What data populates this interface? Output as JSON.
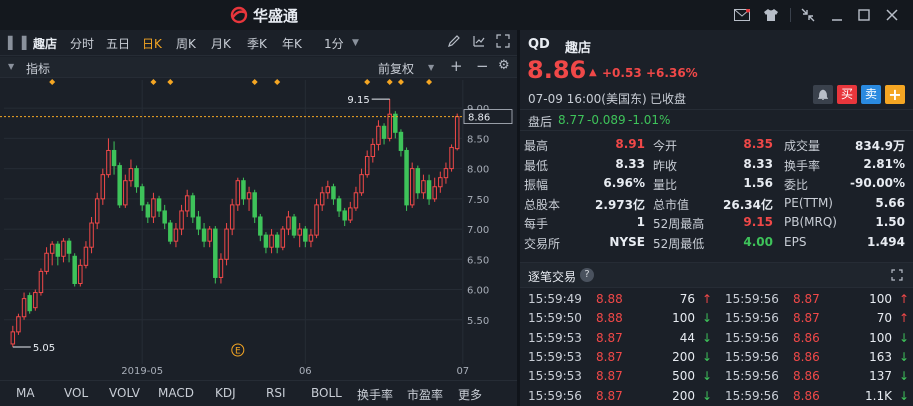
{
  "app": {
    "title": "华盛通",
    "brand_color": "#e8363c"
  },
  "toolbar": {
    "tabs": [
      "趣店",
      "分时",
      "五日",
      "日K",
      "周K",
      "月K",
      "季K",
      "年K",
      "1分"
    ],
    "active_tab": "日K",
    "icons": [
      "pen-icon",
      "draw-icon",
      "crosshair-icon",
      "fullscreen-icon"
    ]
  },
  "indicator_bar": {
    "label": "指标",
    "adjust": "前复权"
  },
  "chart_data": {
    "type": "candlestick",
    "ylim": [
      5.0,
      9.3
    ],
    "y_ticks": [
      "9.00",
      "8.50",
      "8.00",
      "7.50",
      "7.00",
      "6.50",
      "6.00",
      "5.50"
    ],
    "x_ticks": [
      {
        "label": "2019-05",
        "index": 23
      },
      {
        "label": "06",
        "index": 52
      },
      {
        "label": "07",
        "index": 80
      }
    ],
    "price_line": "8.86",
    "high_marker": "9.15",
    "low_marker": "5.05",
    "earnings_marker": {
      "label": "E",
      "index": 40
    },
    "candles": [
      [
        5.1,
        5.3,
        5.05,
        5.4
      ],
      [
        5.3,
        5.55,
        5.25,
        5.6
      ],
      [
        5.55,
        5.85,
        5.5,
        5.95
      ],
      [
        5.9,
        5.65,
        5.6,
        5.95
      ],
      [
        5.7,
        5.95,
        5.65,
        6.0
      ],
      [
        5.95,
        6.3,
        5.9,
        6.35
      ],
      [
        6.3,
        6.6,
        6.25,
        6.7
      ],
      [
        6.6,
        6.75,
        6.4,
        6.8
      ],
      [
        6.75,
        6.55,
        6.4,
        6.8
      ],
      [
        6.55,
        6.8,
        6.45,
        6.85
      ],
      [
        6.8,
        6.6,
        6.45,
        6.85
      ],
      [
        6.55,
        6.1,
        6.05,
        6.6
      ],
      [
        6.1,
        6.4,
        6.05,
        6.5
      ],
      [
        6.4,
        6.7,
        6.35,
        6.8
      ],
      [
        6.7,
        7.1,
        6.6,
        7.2
      ],
      [
        7.1,
        7.5,
        7.0,
        7.6
      ],
      [
        7.5,
        7.9,
        7.4,
        8.0
      ],
      [
        7.9,
        8.3,
        7.85,
        8.5
      ],
      [
        8.3,
        8.05,
        7.9,
        8.45
      ],
      [
        8.05,
        7.4,
        7.35,
        8.1
      ],
      [
        7.4,
        7.8,
        7.35,
        7.9
      ],
      [
        7.8,
        8.0,
        7.7,
        8.15
      ],
      [
        8.0,
        7.7,
        7.6,
        8.05
      ],
      [
        7.7,
        7.4,
        7.3,
        7.75
      ],
      [
        7.4,
        7.2,
        7.1,
        7.45
      ],
      [
        7.2,
        7.5,
        7.1,
        7.6
      ],
      [
        7.5,
        7.3,
        7.2,
        7.55
      ],
      [
        7.3,
        7.1,
        7.0,
        7.4
      ],
      [
        7.1,
        6.8,
        6.75,
        7.15
      ],
      [
        6.8,
        7.0,
        6.7,
        7.1
      ],
      [
        7.0,
        7.3,
        6.9,
        7.4
      ],
      [
        7.3,
        7.55,
        7.2,
        7.65
      ],
      [
        7.55,
        7.2,
        7.1,
        7.6
      ],
      [
        7.2,
        7.0,
        6.9,
        7.3
      ],
      [
        7.0,
        6.8,
        6.7,
        7.1
      ],
      [
        6.8,
        7.0,
        6.7,
        7.05
      ],
      [
        7.0,
        6.2,
        6.1,
        7.05
      ],
      [
        6.2,
        6.5,
        6.1,
        6.6
      ],
      [
        6.5,
        7.0,
        6.4,
        7.1
      ],
      [
        7.0,
        7.4,
        6.9,
        7.5
      ],
      [
        7.4,
        7.8,
        7.3,
        7.85
      ],
      [
        7.8,
        7.5,
        7.4,
        7.85
      ],
      [
        7.5,
        7.6,
        7.3,
        7.7
      ],
      [
        7.6,
        7.2,
        7.1,
        7.65
      ],
      [
        7.2,
        6.9,
        6.8,
        7.25
      ],
      [
        6.9,
        6.7,
        6.6,
        6.95
      ],
      [
        6.7,
        6.9,
        6.6,
        7.0
      ],
      [
        6.9,
        6.7,
        6.6,
        6.95
      ],
      [
        6.7,
        7.0,
        6.65,
        7.05
      ],
      [
        7.0,
        7.2,
        6.9,
        7.3
      ],
      [
        7.2,
        6.9,
        6.85,
        7.25
      ],
      [
        6.9,
        7.0,
        6.7,
        7.1
      ],
      [
        7.0,
        6.8,
        6.7,
        7.05
      ],
      [
        6.8,
        6.9,
        6.7,
        7.0
      ],
      [
        6.9,
        7.4,
        6.85,
        7.5
      ],
      [
        7.4,
        7.6,
        7.3,
        7.7
      ],
      [
        7.6,
        7.7,
        7.5,
        7.8
      ],
      [
        7.7,
        7.5,
        7.4,
        7.75
      ],
      [
        7.5,
        7.3,
        7.2,
        7.55
      ],
      [
        7.3,
        7.15,
        7.05,
        7.35
      ],
      [
        7.15,
        7.35,
        7.1,
        7.45
      ],
      [
        7.35,
        7.6,
        7.3,
        7.7
      ],
      [
        7.6,
        7.9,
        7.55,
        8.0
      ],
      [
        7.9,
        8.2,
        7.85,
        8.3
      ],
      [
        8.2,
        8.4,
        8.1,
        8.5
      ],
      [
        8.4,
        8.7,
        8.3,
        8.8
      ],
      [
        8.7,
        8.5,
        8.4,
        8.75
      ],
      [
        8.5,
        8.9,
        8.45,
        9.15
      ],
      [
        8.9,
        8.6,
        8.5,
        8.95
      ],
      [
        8.6,
        8.3,
        8.2,
        8.65
      ],
      [
        8.3,
        7.4,
        7.3,
        8.35
      ],
      [
        7.4,
        8.0,
        7.35,
        8.1
      ],
      [
        8.0,
        7.6,
        7.5,
        8.05
      ],
      [
        7.6,
        7.8,
        7.5,
        7.9
      ],
      [
        7.8,
        7.5,
        7.4,
        7.9
      ],
      [
        7.5,
        7.7,
        7.45,
        7.85
      ],
      [
        7.7,
        7.85,
        7.6,
        7.95
      ],
      [
        7.85,
        8.0,
        7.75,
        8.1
      ],
      [
        8.0,
        8.35,
        7.95,
        8.4
      ],
      [
        8.33,
        8.86,
        8.3,
        8.91
      ]
    ]
  },
  "bottom_tabs": [
    "MA",
    "VOL",
    "VOLV",
    "MACD",
    "KDJ",
    "RSI",
    "BOLL",
    "换手率",
    "市盈率",
    "更多"
  ],
  "quote": {
    "symbol": "QD",
    "name": "趣店",
    "price": "8.86",
    "change": "+0.53",
    "change_pct": "+6.36%",
    "time": "07-09  16:00(美国东)",
    "status": "已收盘",
    "buy_label": "买",
    "sell_label": "卖",
    "add_label": "+",
    "post_label": "盘后",
    "post_price": "8.77",
    "post_change": "-0.089",
    "post_pct": "-1.01%"
  },
  "stats": [
    [
      {
        "label": "最高",
        "value": "8.91",
        "color": "red"
      },
      {
        "label": "今开",
        "value": "8.35",
        "color": "red"
      },
      {
        "label": "成交量",
        "value": "834.9万",
        "color": "white"
      }
    ],
    [
      {
        "label": "最低",
        "value": "8.33",
        "color": "white"
      },
      {
        "label": "昨收",
        "value": "8.33",
        "color": "white"
      },
      {
        "label": "换手率",
        "value": "2.81%",
        "color": "white"
      }
    ],
    [
      {
        "label": "振幅",
        "value": "6.96%",
        "color": "white"
      },
      {
        "label": "量比",
        "value": "1.56",
        "color": "white"
      },
      {
        "label": "委比",
        "value": "-90.00%",
        "color": "white"
      }
    ],
    [
      {
        "label": "总股本",
        "value": "2.973亿",
        "color": "white"
      },
      {
        "label": "总市值",
        "value": "26.34亿",
        "color": "white"
      },
      {
        "label": "PE(TTM)",
        "value": "5.66",
        "color": "white"
      }
    ],
    [
      {
        "label": "每手",
        "value": "1",
        "color": "white"
      },
      {
        "label": "52周最高",
        "value": "9.15",
        "color": "red"
      },
      {
        "label": "PB(MRQ)",
        "value": "1.50",
        "color": "white"
      }
    ],
    [
      {
        "label": "交易所",
        "value": "NYSE",
        "color": "white"
      },
      {
        "label": "52周最低",
        "value": "4.00",
        "color": "green"
      },
      {
        "label": "EPS",
        "value": "1.494",
        "color": "white"
      }
    ]
  ],
  "trades": {
    "title": "逐笔交易",
    "help": "?",
    "left": [
      {
        "time": "15:59:49",
        "price": "8.88",
        "vol": "76",
        "dir": "up"
      },
      {
        "time": "15:59:50",
        "price": "8.88",
        "vol": "100",
        "dir": "down"
      },
      {
        "time": "15:59:53",
        "price": "8.87",
        "vol": "44",
        "dir": "down"
      },
      {
        "time": "15:59:53",
        "price": "8.87",
        "vol": "200",
        "dir": "down"
      },
      {
        "time": "15:59:53",
        "price": "8.87",
        "vol": "500",
        "dir": "down"
      },
      {
        "time": "15:59:56",
        "price": "8.87",
        "vol": "200",
        "dir": "down"
      }
    ],
    "right": [
      {
        "time": "15:59:56",
        "price": "8.87",
        "vol": "100",
        "dir": "up"
      },
      {
        "time": "15:59:56",
        "price": "8.87",
        "vol": "70",
        "dir": "up"
      },
      {
        "time": "15:59:56",
        "price": "8.86",
        "vol": "100",
        "dir": "down"
      },
      {
        "time": "15:59:56",
        "price": "8.86",
        "vol": "163",
        "dir": "down"
      },
      {
        "time": "15:59:56",
        "price": "8.86",
        "vol": "137",
        "dir": "down"
      },
      {
        "time": "15:59:56",
        "price": "8.86",
        "vol": "1.1K",
        "dir": "down"
      }
    ]
  }
}
